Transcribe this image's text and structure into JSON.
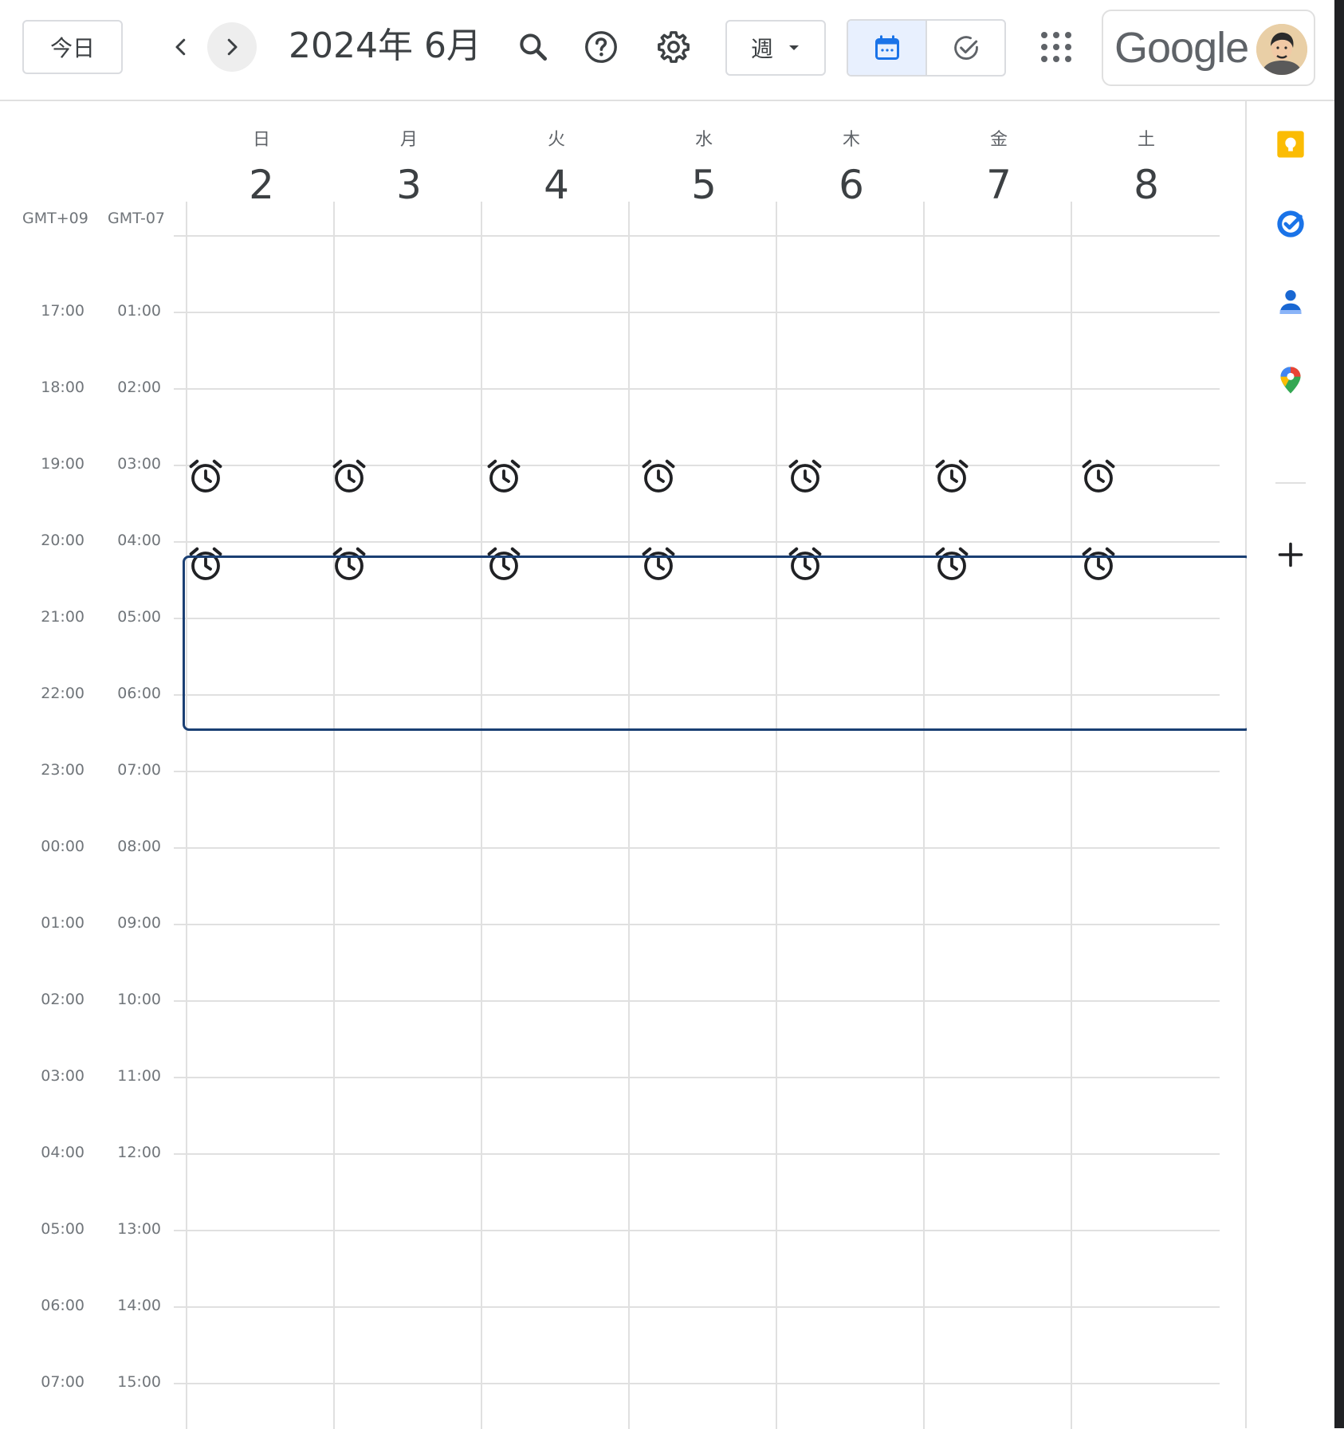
{
  "header": {
    "today_label": "今日",
    "title": "2024年 6月",
    "view_label": "週",
    "brand": "Google"
  },
  "timezones": {
    "primary": "GMT+09",
    "secondary": "GMT-07"
  },
  "days": [
    {
      "dow": "日",
      "date": "2"
    },
    {
      "dow": "月",
      "date": "3"
    },
    {
      "dow": "火",
      "date": "4"
    },
    {
      "dow": "水",
      "date": "5"
    },
    {
      "dow": "木",
      "date": "6"
    },
    {
      "dow": "金",
      "date": "7"
    },
    {
      "dow": "土",
      "date": "8"
    }
  ],
  "time_rows": [
    {
      "primary": "17:00",
      "secondary": "01:00"
    },
    {
      "primary": "18:00",
      "secondary": "02:00"
    },
    {
      "primary": "19:00",
      "secondary": "03:00"
    },
    {
      "primary": "20:00",
      "secondary": "04:00"
    },
    {
      "primary": "21:00",
      "secondary": "05:00"
    },
    {
      "primary": "22:00",
      "secondary": "06:00"
    },
    {
      "primary": "23:00",
      "secondary": "07:00"
    },
    {
      "primary": "00:00",
      "secondary": "08:00"
    },
    {
      "primary": "01:00",
      "secondary": "09:00"
    },
    {
      "primary": "02:00",
      "secondary": "10:00"
    },
    {
      "primary": "03:00",
      "secondary": "11:00"
    },
    {
      "primary": "04:00",
      "secondary": "12:00"
    },
    {
      "primary": "05:00",
      "secondary": "13:00"
    },
    {
      "primary": "06:00",
      "secondary": "14:00"
    },
    {
      "primary": "07:00",
      "secondary": "15:00"
    }
  ],
  "alarm_rows": [
    "19:00",
    "20:00"
  ],
  "icons": {
    "prev": "chevron-left-icon",
    "next": "chevron-right-icon",
    "search": "search-icon",
    "help": "help-icon",
    "settings": "gear-icon",
    "calendar_view": "calendar-icon",
    "tasks_view": "check-circle-icon",
    "apps": "apps-grid-icon",
    "alarm": "alarm-clock-icon",
    "side": [
      "keep-icon",
      "tasks-icon",
      "contacts-icon",
      "maps-icon",
      "add-icon"
    ]
  },
  "colors": {
    "accent": "#1a73e8",
    "highlight_border": "#1a3f73",
    "keep": "#fbbc04",
    "tasks": "#1a73e8",
    "contacts": "#1967d2"
  }
}
